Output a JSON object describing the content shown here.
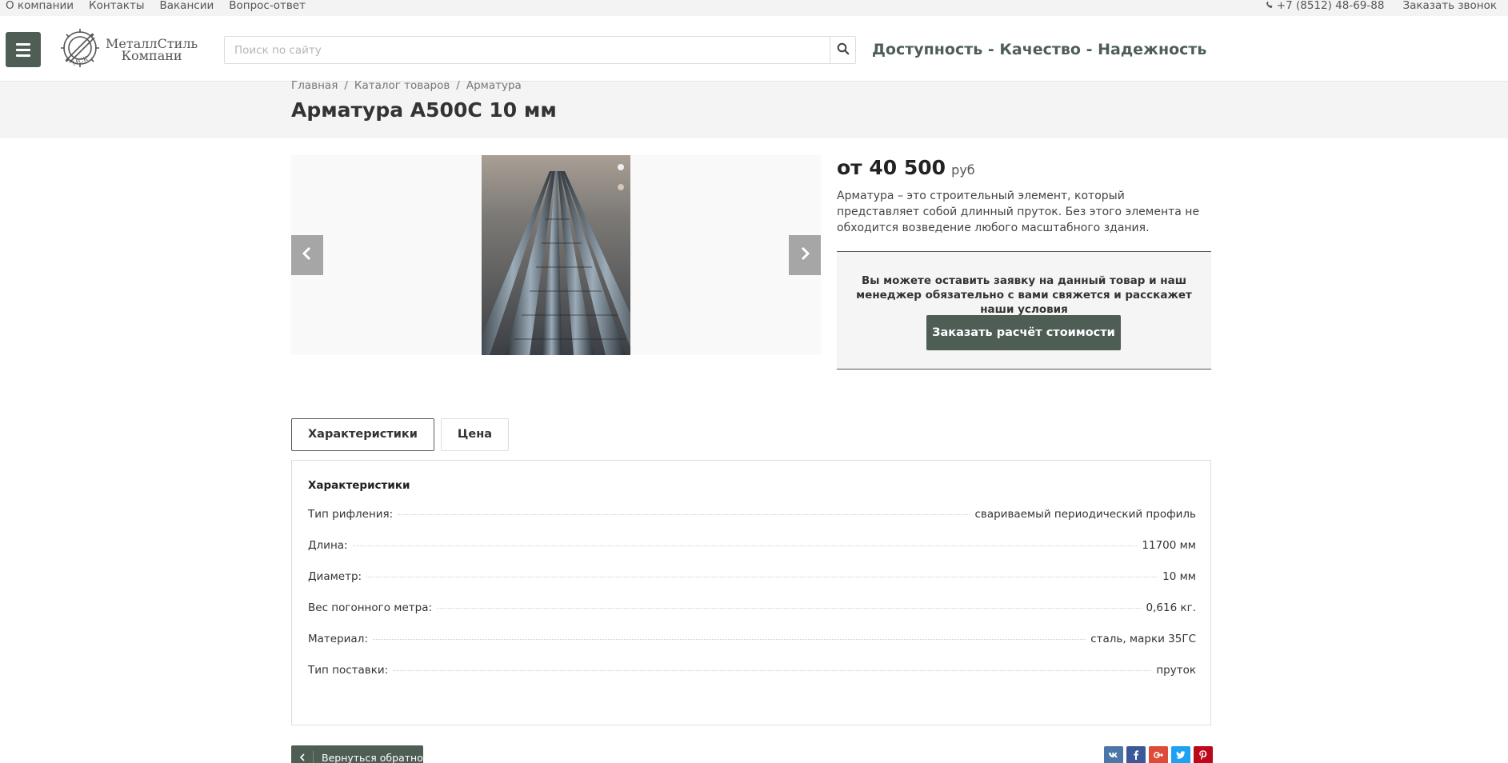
{
  "topbar": {
    "links": [
      {
        "label": "О компании"
      },
      {
        "label": "Контакты"
      },
      {
        "label": "Вакансии"
      },
      {
        "label": "Вопрос-ответ"
      }
    ],
    "phone": "+7 (8512) 48-69-88",
    "callback": "Заказать звонок"
  },
  "header": {
    "logo_line1": "МеталлСтиль",
    "logo_line2": "Компани",
    "logo_mark": "МСК",
    "search_placeholder": "Поиск по сайту",
    "slogan": "Доступность - Качество - Надежность"
  },
  "breadcrumb": {
    "items": [
      {
        "label": "Главная"
      },
      {
        "label": "Каталог товаров"
      },
      {
        "label": "Арматура"
      }
    ],
    "separator": "/"
  },
  "product": {
    "title": "Арматура А500С 10 мм",
    "price_amount": "от 40 500",
    "price_currency": "руб",
    "description": "Арматура – это строительный элемент, который представляет собой длинный пруток. Без этого элемента не обходится возведение любого масштабного здания.",
    "request_text": "Вы можете оставить заявку на данный товар и наш менеджер обязательно с вами свяжется и расскажет наши условия",
    "order_button": "Заказать расчёт стоимости"
  },
  "tabs": [
    {
      "label": "Характеристики",
      "active": true
    },
    {
      "label": "Цена",
      "active": false
    }
  ],
  "specs": {
    "title": "Характеристики",
    "rows": [
      {
        "key": "Тип рифления:",
        "value": "свариваемый периодический профиль"
      },
      {
        "key": "Длина:",
        "value": "11700 мм"
      },
      {
        "key": "Диаметр:",
        "value": "10 мм"
      },
      {
        "key": "Вес погонного метра:",
        "value": "0,616 кг."
      },
      {
        "key": "Материал:",
        "value": "сталь, марки 35ГС"
      },
      {
        "key": "Тип поставки:",
        "value": "пруток"
      }
    ]
  },
  "back_button": "Вернуться обратно",
  "social": [
    {
      "name": "vk-icon",
      "color": "#4a76a8"
    },
    {
      "name": "facebook-icon",
      "color": "#3b5998"
    },
    {
      "name": "google-plus-icon",
      "color": "#dd4b39"
    },
    {
      "name": "twitter-icon",
      "color": "#1da1f2"
    },
    {
      "name": "pinterest-icon",
      "color": "#bd081c"
    }
  ],
  "colors": {
    "accent": "#4e5e55",
    "topbar_bg": "#f3f3f3",
    "band_bg": "#f4f4f4"
  }
}
